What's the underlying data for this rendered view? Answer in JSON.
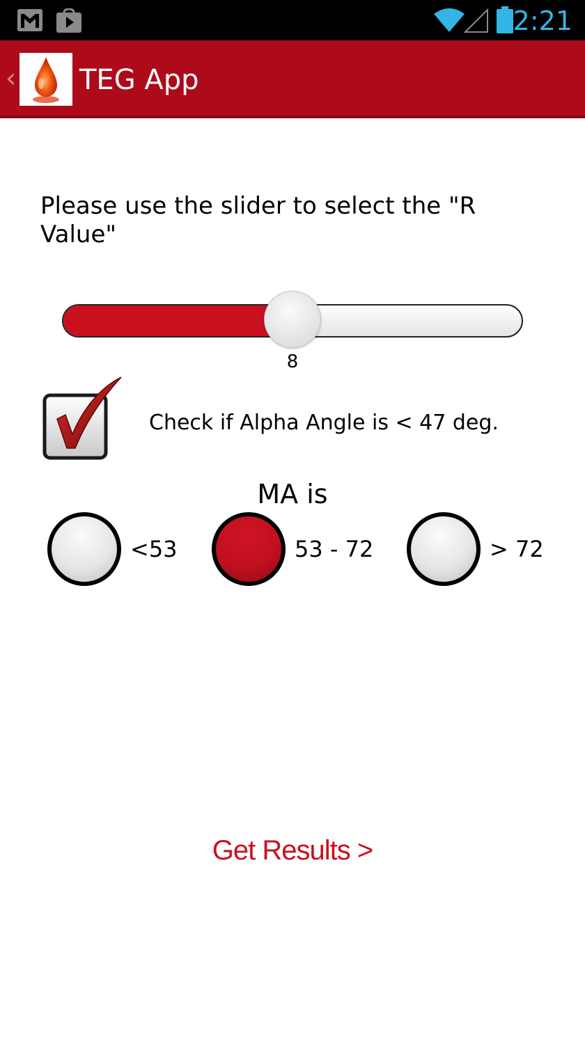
{
  "status_bar": {
    "time": "2:21",
    "notification_icons": [
      "gmail-icon",
      "play-store-icon"
    ],
    "system_icons": [
      "wifi-icon",
      "signal-icon",
      "battery-icon"
    ],
    "clock_color": "#33b5e5"
  },
  "action_bar": {
    "title": "TEG App",
    "logo_icon": "blood-drop-icon",
    "background_color": "#ad0b1a"
  },
  "slider_section": {
    "prompt": "Please use the slider to select the \"R Value\"",
    "value": "8",
    "fill_fraction": 0.5,
    "fill_color": "#c8101f"
  },
  "alpha_angle": {
    "label": "Check if Alpha Angle is < 47 deg.",
    "checked": true
  },
  "ma": {
    "heading": "MA is",
    "options": [
      {
        "label": "<53",
        "selected": false
      },
      {
        "label": "53 - 72",
        "selected": true
      },
      {
        "label": "> 72",
        "selected": false
      }
    ]
  },
  "footer": {
    "results_link": "Get Results >"
  }
}
